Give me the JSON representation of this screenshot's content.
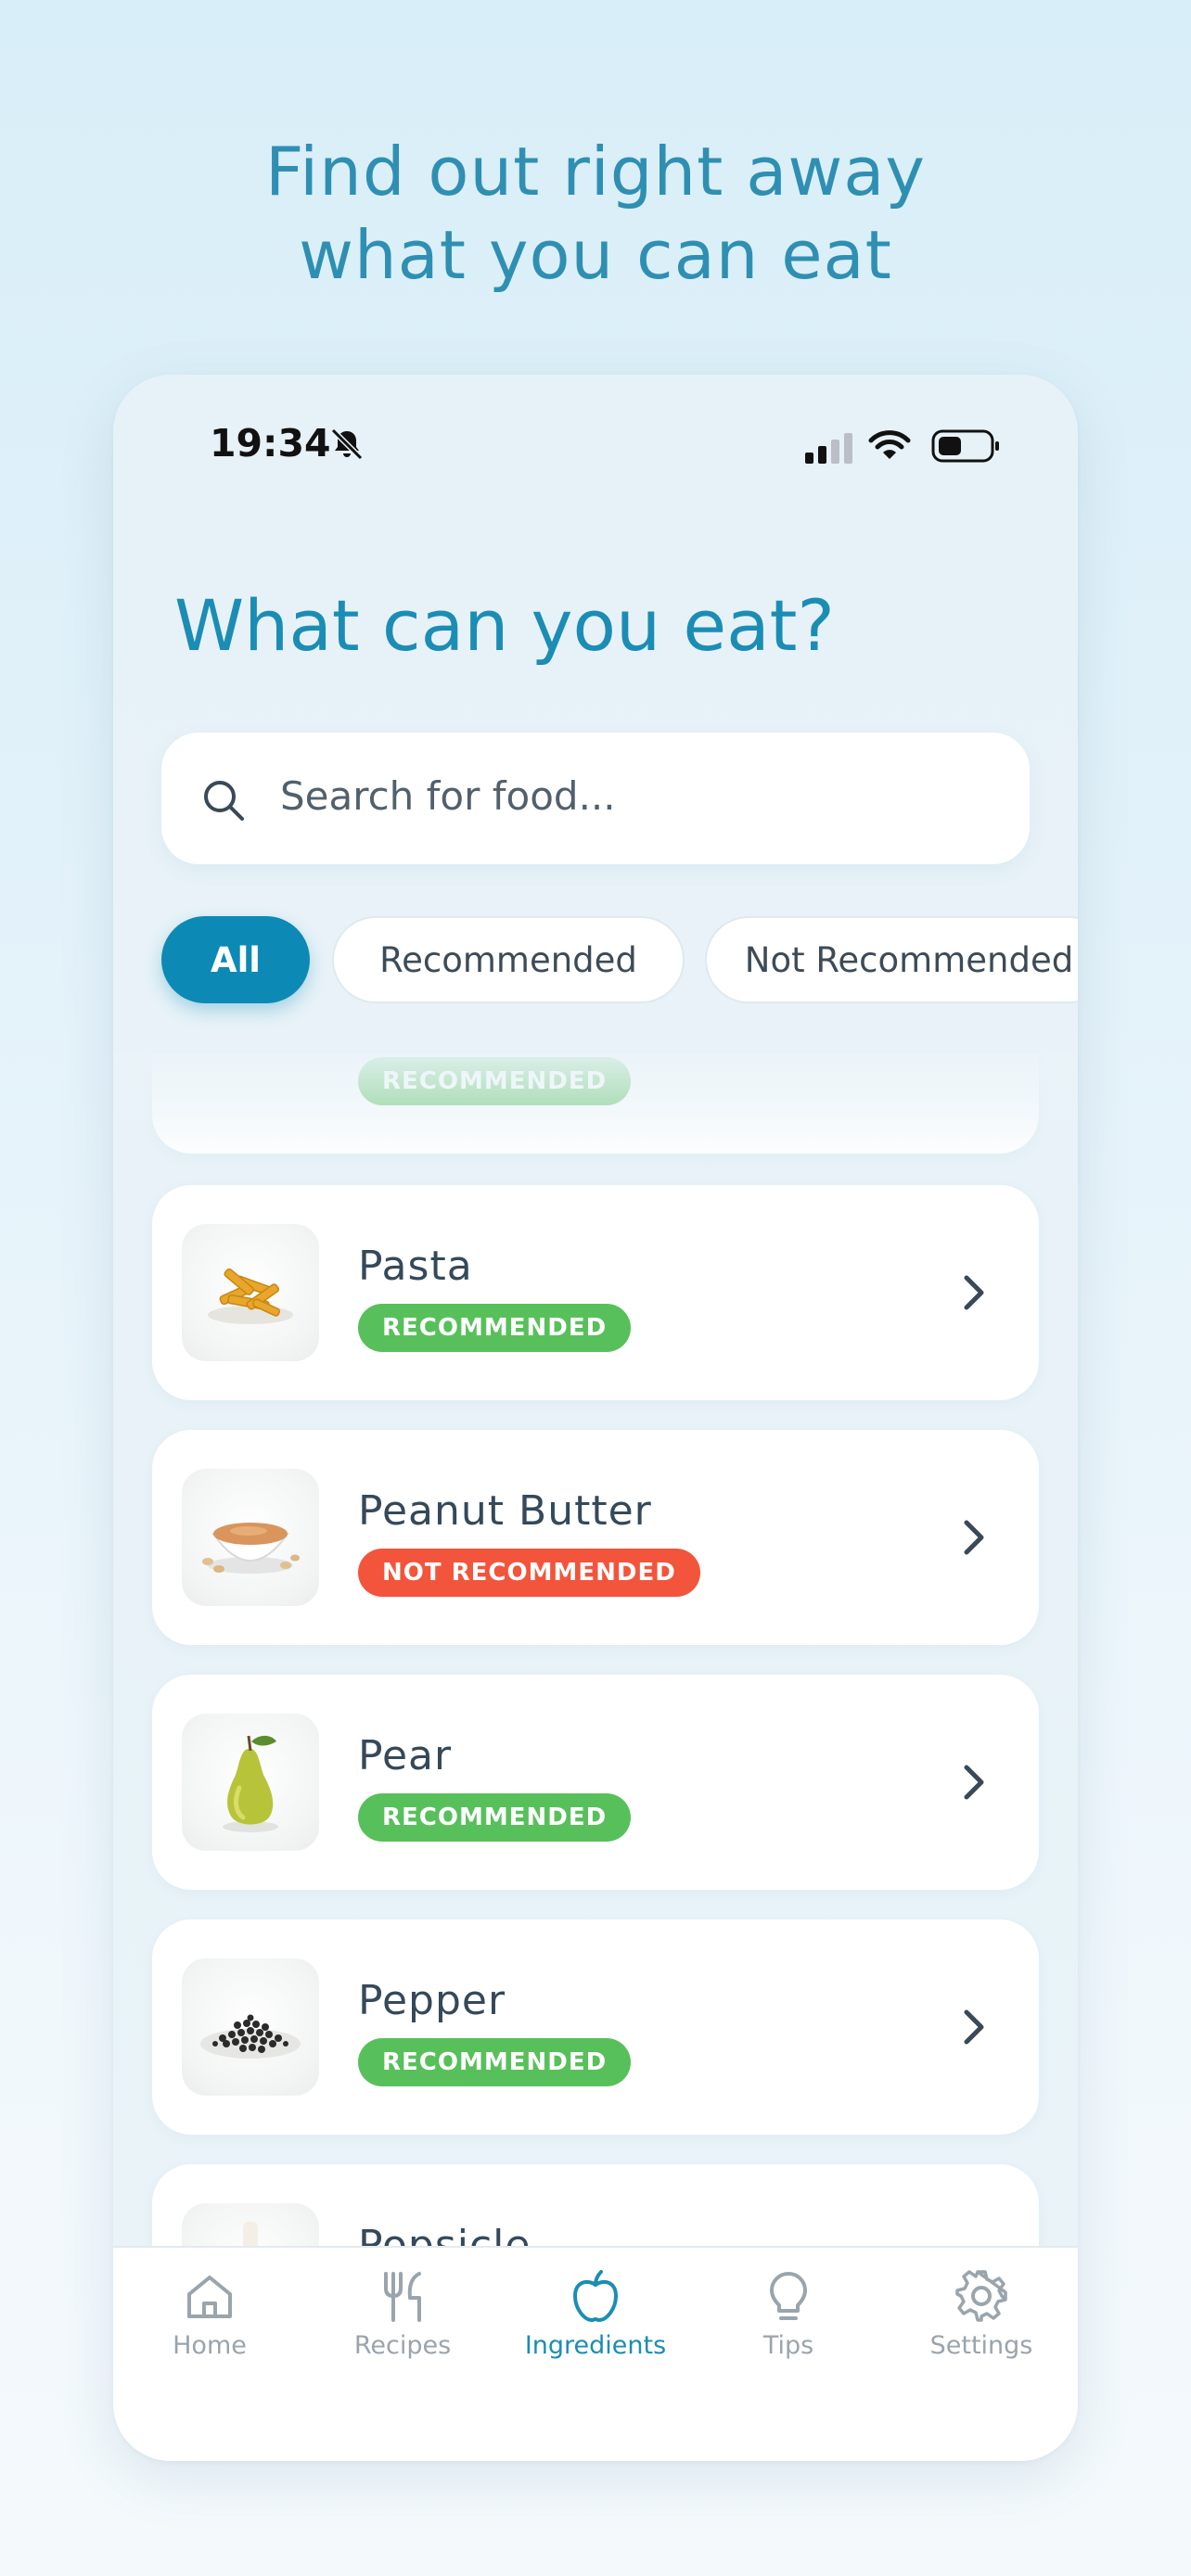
{
  "headline": {
    "line1": "Find out right away",
    "line2": "what you can eat"
  },
  "status_bar": {
    "time": "19:34"
  },
  "page_title": "What can you eat?",
  "search": {
    "placeholder": "Search for food..."
  },
  "filters": [
    "All",
    "Recommended",
    "Not Recommended"
  ],
  "active_filter": "All",
  "foods": [
    {
      "name": "",
      "status": "RECOMMENDED",
      "status_type": "recommended",
      "partial": true
    },
    {
      "name": "Pasta",
      "status": "RECOMMENDED",
      "status_type": "recommended",
      "image": "pasta"
    },
    {
      "name": "Peanut Butter",
      "status": "NOT RECOMMENDED",
      "status_type": "not-recommended",
      "image": "peanut-butter"
    },
    {
      "name": "Pear",
      "status": "RECOMMENDED",
      "status_type": "recommended",
      "image": "pear"
    },
    {
      "name": "Pepper",
      "status": "RECOMMENDED",
      "status_type": "recommended",
      "image": "pepper"
    },
    {
      "name": "Popsicle",
      "status": "",
      "status_type": "",
      "image": "popsicle",
      "partial": true
    }
  ],
  "tab_bar": {
    "items": [
      {
        "label": "Home",
        "icon": "home-icon"
      },
      {
        "label": "Recipes",
        "icon": "fork-knife-icon"
      },
      {
        "label": "Ingredients",
        "icon": "apple-icon"
      },
      {
        "label": "Tips",
        "icon": "lightbulb-icon"
      },
      {
        "label": "Settings",
        "icon": "gear-icon"
      }
    ],
    "active": "Ingredients"
  },
  "colors": {
    "accent": "#1b8db5",
    "chip_active": "#0c8ab5",
    "recommended": "#58c05a",
    "not_recommended": "#f2553c",
    "headline": "#2f8fb3"
  }
}
